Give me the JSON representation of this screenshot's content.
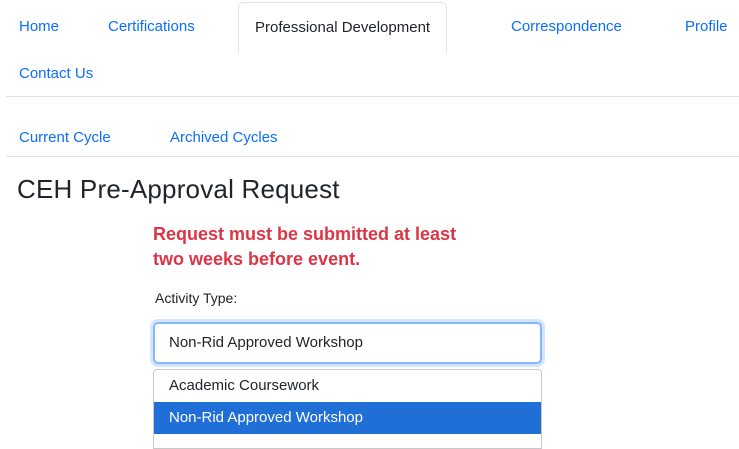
{
  "nav": {
    "tabs": [
      "Home",
      "Certifications",
      "Professional Development",
      "Correspondence",
      "Profile",
      "Contact Us"
    ],
    "active": "Professional Development"
  },
  "subnav": {
    "tabs": [
      "Current Cycle",
      "Archived Cycles"
    ]
  },
  "page": {
    "title": "CEH Pre-Approval Request",
    "warning_line1": "Request must be submitted at least",
    "warning_line2": "two weeks before event."
  },
  "form": {
    "activity_label": "Activity Type:",
    "activity_value": "Non-Rid Approved Workshop",
    "options": [
      "Academic Coursework",
      "Non-Rid Approved Workshop"
    ],
    "highlighted_option": "Non-Rid Approved Workshop"
  },
  "colors": {
    "link": "#0d6efd",
    "warning": "#dc3545",
    "highlight": "#1f6fd6",
    "focus_border": "#86b7fe"
  }
}
